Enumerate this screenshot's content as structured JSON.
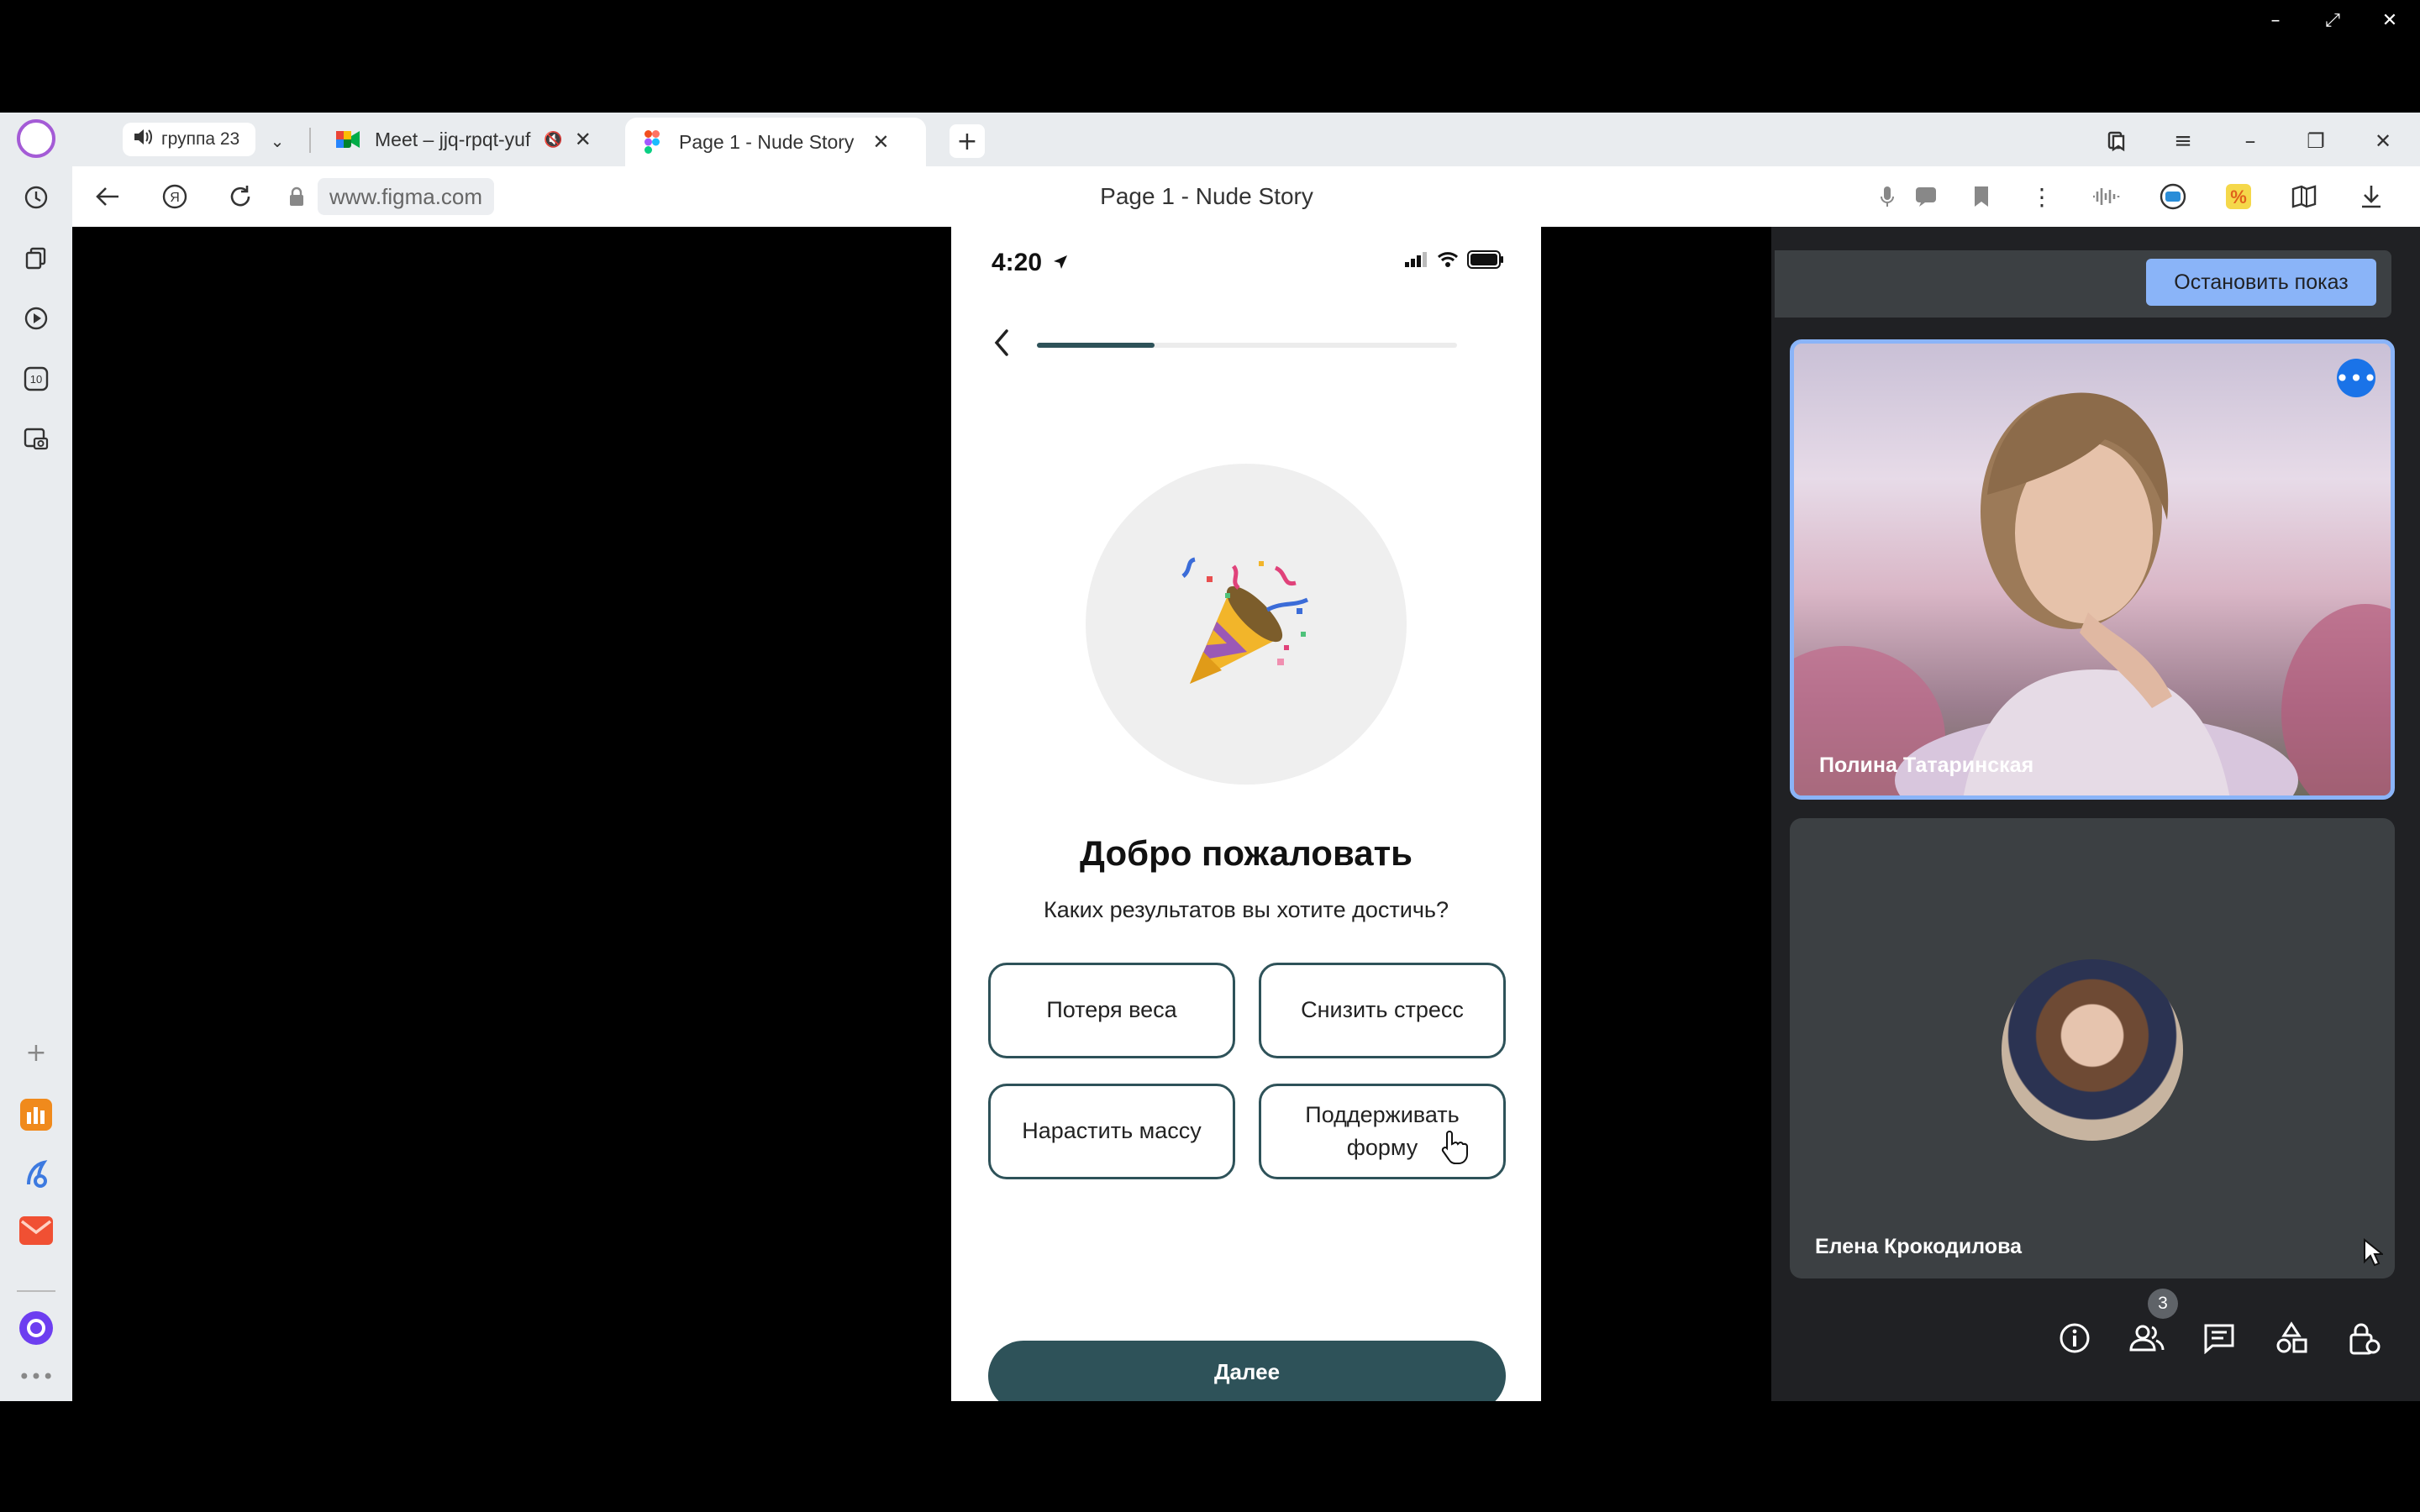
{
  "browser": {
    "tab_count": "0",
    "tab_group_label": "группа 23",
    "tabs": [
      {
        "label": "Meet – jjq-rpqt-yuf",
        "icon": "google-meet-icon"
      },
      {
        "label": "Page 1 - Nude Story",
        "icon": "figma-icon"
      }
    ],
    "url": "www.figma.com",
    "page_title": "Page 1 - Nude Story"
  },
  "phone": {
    "time": "4:20",
    "progress": 0.28,
    "emoji": "🎉",
    "title": "Добро пожаловать",
    "question": "Каких результатов вы хотите достичь?",
    "goals": [
      "Потеря веса",
      "Снизить стресс",
      "Нарастить массу",
      "Поддерживать форму"
    ],
    "next_label": "Далее"
  },
  "meet": {
    "stop_label": "Остановить показ",
    "participants": [
      {
        "name": "Полина Татаринская"
      },
      {
        "name": "Елена Крокодилова"
      }
    ],
    "people_count": "3"
  },
  "colors": {
    "accent": "#2e5259",
    "meet_blue": "#8ab4f8",
    "meet_bg": "#202124"
  }
}
